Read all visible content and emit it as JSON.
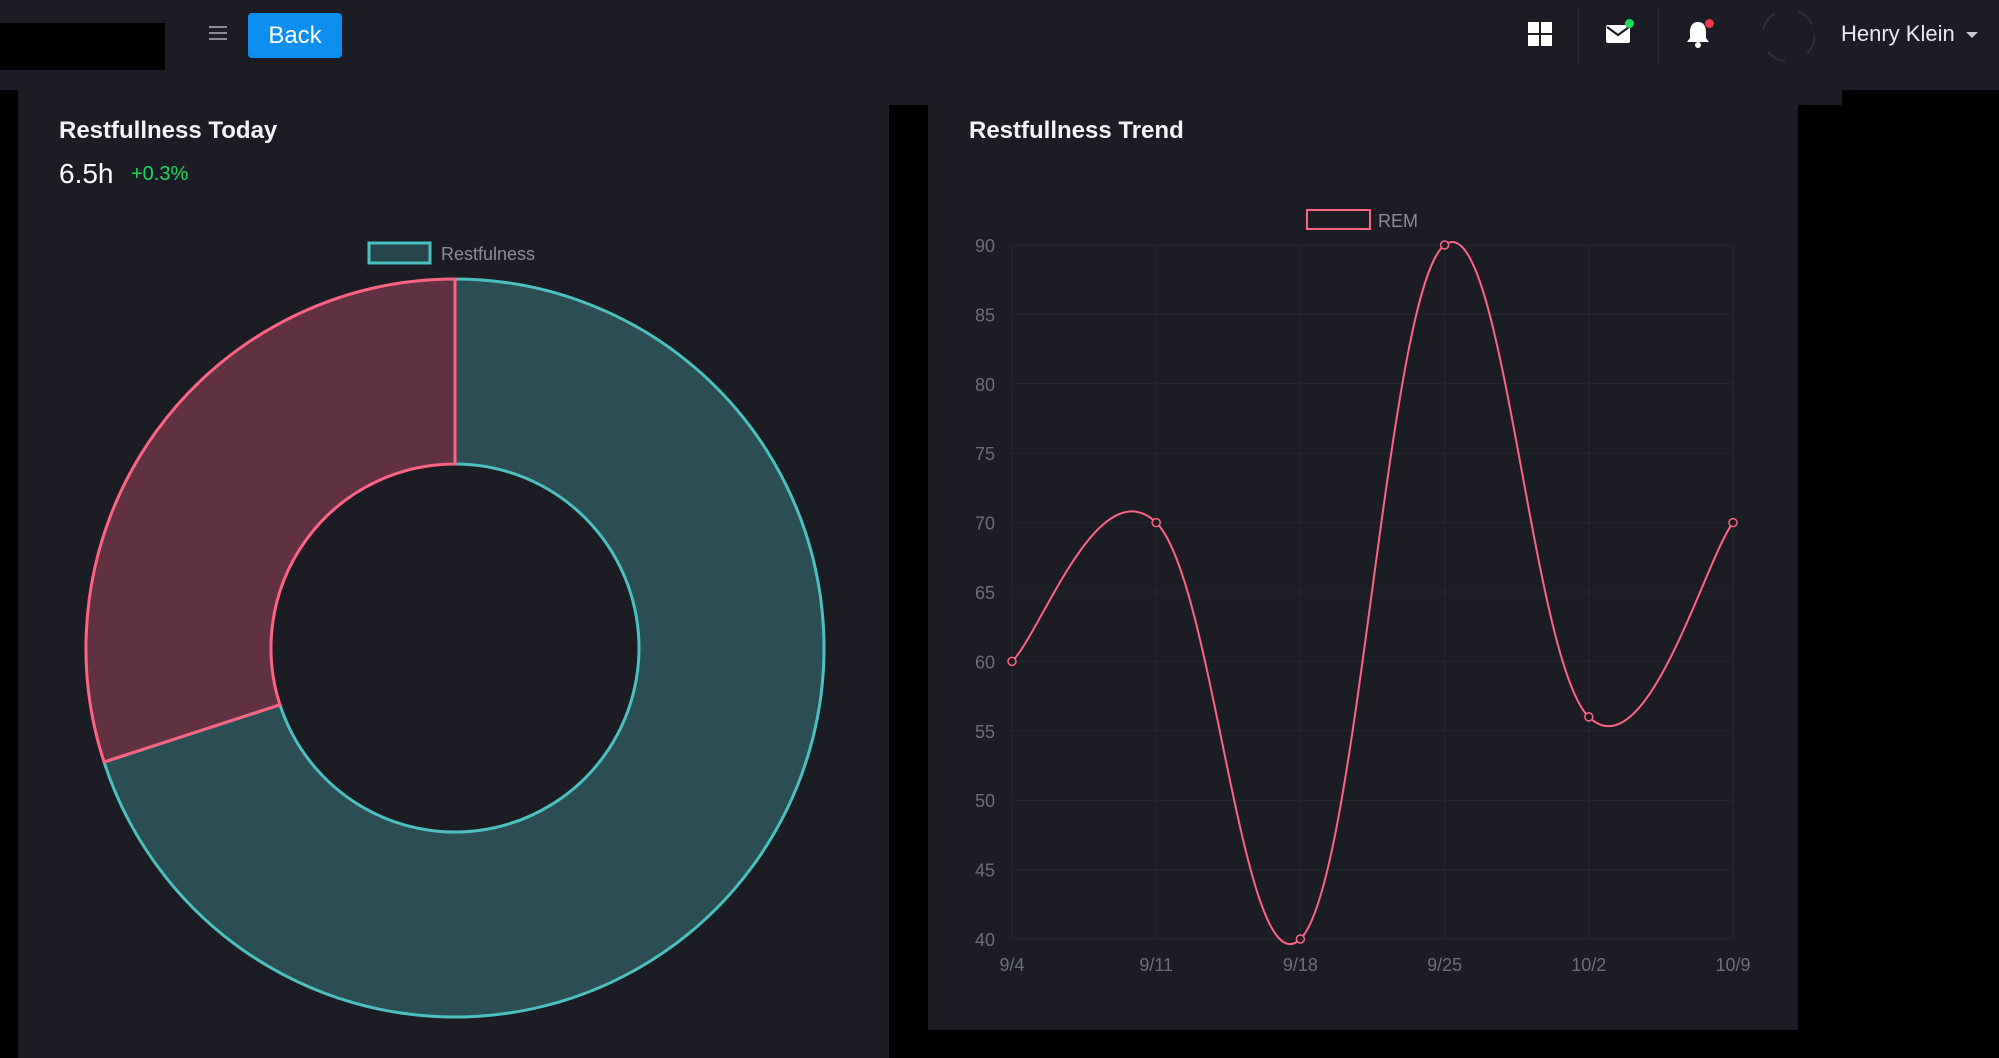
{
  "header": {
    "back_label": "Back",
    "user_name": "Henry Klein",
    "icons": [
      "menu-icon",
      "grid-icon",
      "mail-icon",
      "bell-icon"
    ]
  },
  "colors": {
    "background": "#1c1d24",
    "accent_blue": "#0d8ff2",
    "teal": "#4bc0c0",
    "pink": "#ff6384",
    "positive": "#1ed760",
    "mail_dot": "#1ed760",
    "bell_dot": "#f2364f"
  },
  "today": {
    "title": "Restfullness Today",
    "value": "6.5h",
    "change": "+0.3%"
  },
  "trend": {
    "title": "Restfullness Trend"
  },
  "chart_data": [
    {
      "type": "pie",
      "variant": "doughnut",
      "legend": [
        "Restfulness"
      ],
      "legend_position": "top",
      "slices": [
        {
          "color": "#4bc0c0",
          "value": 70
        },
        {
          "color": "#ff6384",
          "value": 30
        }
      ]
    },
    {
      "type": "line",
      "legend": [
        "REM"
      ],
      "legend_position": "top",
      "categories": [
        "9/4",
        "9/11",
        "9/18",
        "9/25",
        "10/2",
        "10/9"
      ],
      "series": [
        {
          "name": "REM",
          "color": "#ff6384",
          "values": [
            60,
            70,
            40,
            90,
            56,
            70
          ]
        }
      ],
      "ylim": [
        40,
        90
      ],
      "yticks": [
        40,
        45,
        50,
        55,
        60,
        65,
        70,
        75,
        80,
        85,
        90
      ],
      "grid": true,
      "smooth": true
    }
  ]
}
